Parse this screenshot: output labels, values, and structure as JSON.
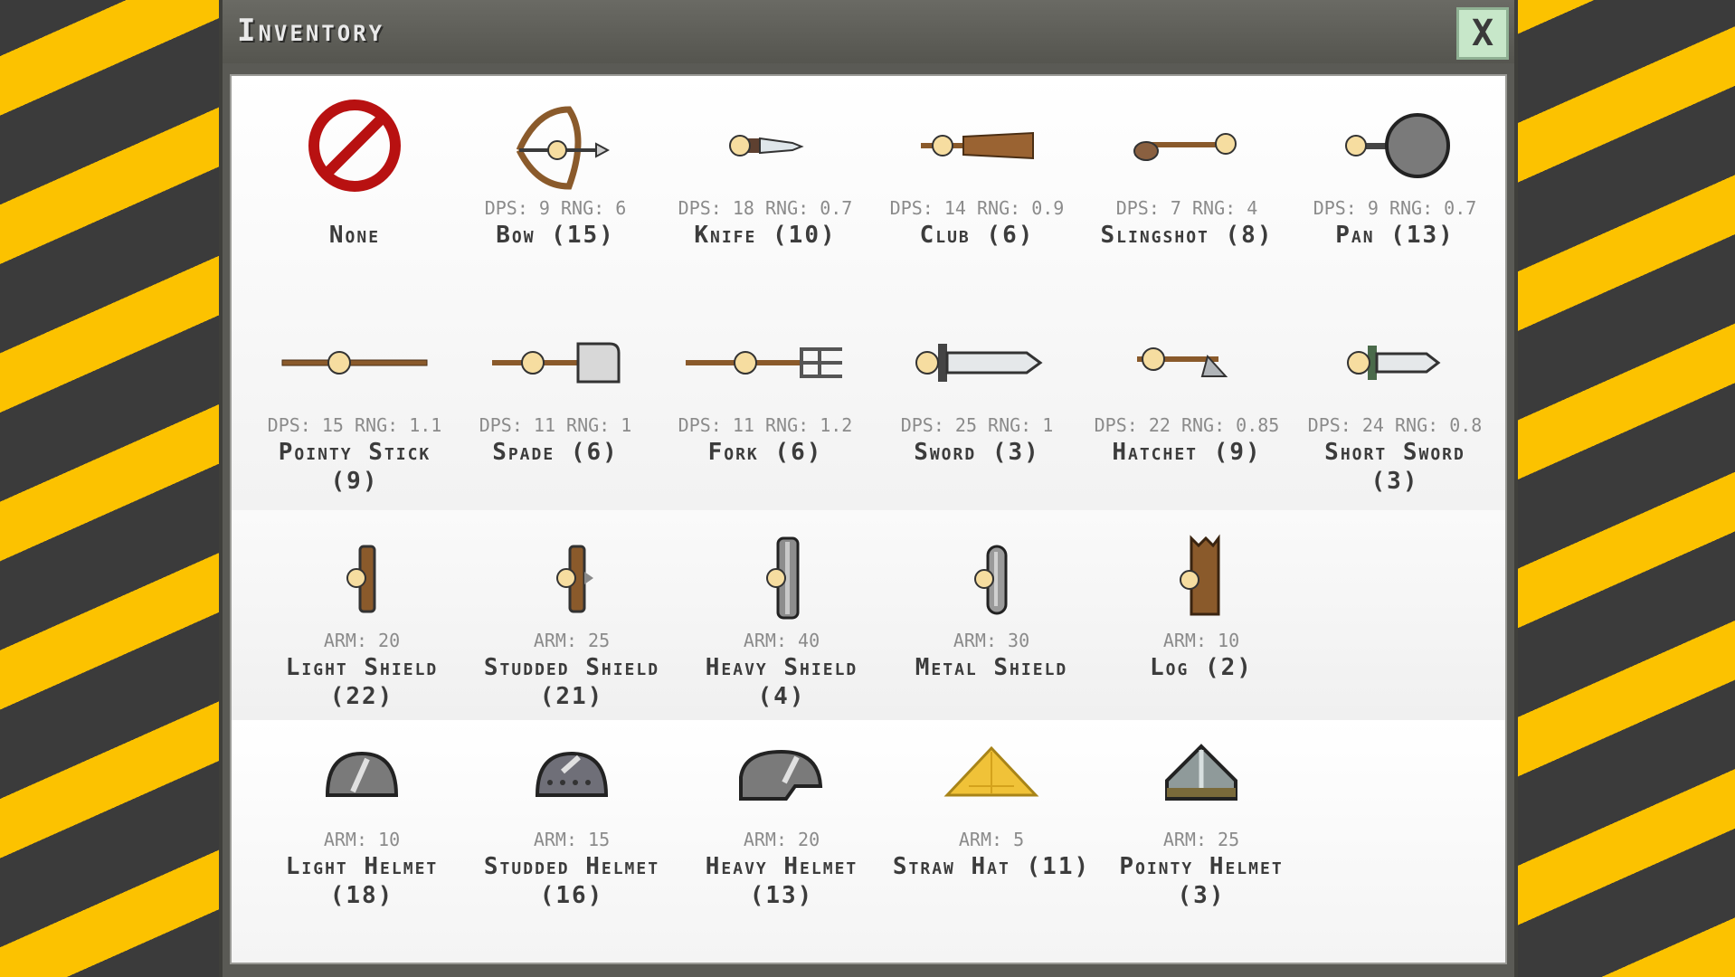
{
  "window": {
    "title": "Inventory",
    "close_label": "X"
  },
  "colors": {
    "stripe_yellow": "#fcc200",
    "stripe_dark": "#3b3b3b",
    "panel": "#ffffff",
    "close_bg": "#c7e7c9"
  },
  "weapons_row1": [
    {
      "icon": "none-icon",
      "stats": "",
      "name": "None"
    },
    {
      "icon": "bow-icon",
      "stats": "DPS: 9 RNG: 6",
      "name": "Bow (15)"
    },
    {
      "icon": "knife-icon",
      "stats": "DPS: 18 RNG: 0.7",
      "name": "Knife (10)"
    },
    {
      "icon": "club-icon",
      "stats": "DPS: 14 RNG: 0.9",
      "name": "Club (6)"
    },
    {
      "icon": "slingshot-icon",
      "stats": "DPS: 7 RNG: 4",
      "name": "Slingshot (8)"
    },
    {
      "icon": "pan-icon",
      "stats": "DPS: 9 RNG: 0.7",
      "name": "Pan (13)"
    }
  ],
  "weapons_row2": [
    {
      "icon": "pointy-stick-icon",
      "stats": "DPS: 15 RNG: 1.1",
      "name": "Pointy Stick (9)"
    },
    {
      "icon": "spade-icon",
      "stats": "DPS: 11 RNG: 1",
      "name": "Spade (6)"
    },
    {
      "icon": "fork-icon",
      "stats": "DPS: 11 RNG: 1.2",
      "name": "Fork (6)"
    },
    {
      "icon": "sword-icon",
      "stats": "DPS: 25 RNG: 1",
      "name": "Sword (3)"
    },
    {
      "icon": "hatchet-icon",
      "stats": "DPS: 22 RNG: 0.85",
      "name": "Hatchet (9)"
    },
    {
      "icon": "short-sword-icon",
      "stats": "DPS: 24 RNG: 0.8",
      "name": "Short Sword (3)"
    }
  ],
  "shields": [
    {
      "icon": "light-shield-icon",
      "stats": "ARM: 20",
      "name": "Light Shield (22)"
    },
    {
      "icon": "studded-shield-icon",
      "stats": "ARM: 25",
      "name": "Studded Shield (21)"
    },
    {
      "icon": "heavy-shield-icon",
      "stats": "ARM: 40",
      "name": "Heavy Shield (4)"
    },
    {
      "icon": "metal-shield-icon",
      "stats": "ARM: 30",
      "name": "Metal Shield"
    },
    {
      "icon": "log-icon",
      "stats": "ARM: 10",
      "name": "Log (2)"
    }
  ],
  "helmets": [
    {
      "icon": "light-helmet-icon",
      "stats": "ARM: 10",
      "name": "Light Helmet (18)"
    },
    {
      "icon": "studded-helmet-icon",
      "stats": "ARM: 15",
      "name": "Studded Helmet (16)"
    },
    {
      "icon": "heavy-helmet-icon",
      "stats": "ARM: 20",
      "name": "Heavy Helmet (13)"
    },
    {
      "icon": "straw-hat-icon",
      "stats": "ARM: 5",
      "name": "Straw Hat (11)"
    },
    {
      "icon": "pointy-helmet-icon",
      "stats": "ARM: 25",
      "name": "Pointy Helmet (3)"
    }
  ]
}
